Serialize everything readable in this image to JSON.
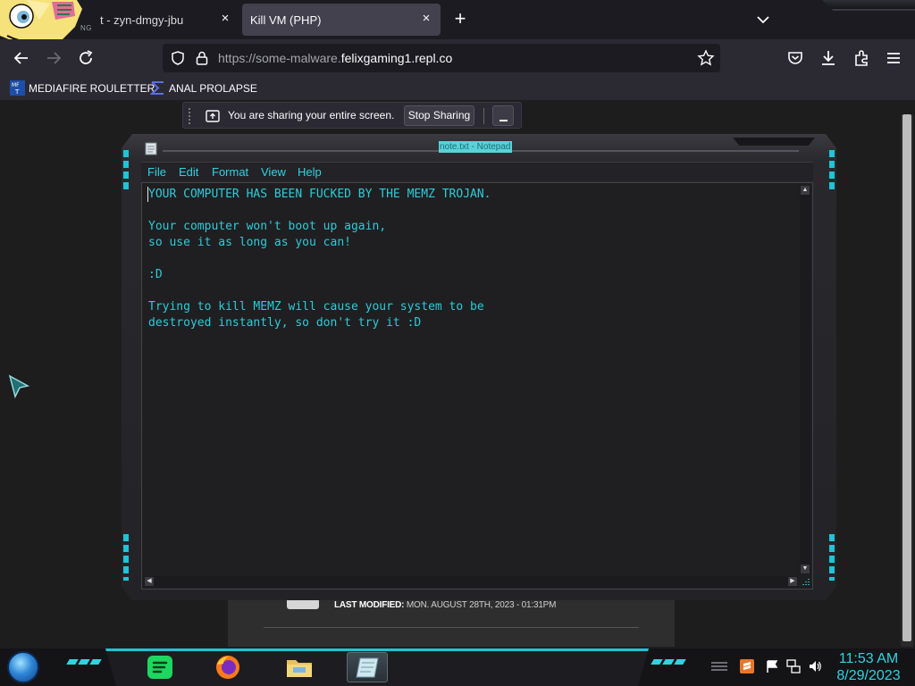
{
  "browser": {
    "tabs": [
      {
        "title": "t - zyn-dmgy-jbu",
        "subtitle": "NG",
        "close_glyph": "×"
      },
      {
        "title": "Kill VM (PHP)",
        "close_glyph": "×"
      }
    ],
    "new_tab_glyph": "+",
    "url": {
      "prefix": "https://some-malware.",
      "domain": "felixgaming1.repl.co"
    },
    "bookmarks": [
      {
        "label": "MEDIAFIRE ROULETTER",
        "icon": "mediafire-icon"
      },
      {
        "label": "ANAL PROLAPSE",
        "icon": "sigma-icon"
      }
    ]
  },
  "sharing": {
    "message": "You are sharing your entire screen.",
    "stop_label": "Stop Sharing"
  },
  "page_card": {
    "modified_label": "LAST MODIFIED:",
    "modified_value": "MON. AUGUST 28TH, 2023 - 01:31PM"
  },
  "notepad": {
    "title": "note.txt - Notepad",
    "menu": [
      "File",
      "Edit",
      "Format",
      "View",
      "Help"
    ],
    "content": "YOUR COMPUTER HAS BEEN FUCKED BY THE MEMZ TROJAN.\n\nYour computer won't boot up again,\nso use it as long as you can!\n\n:D\n\nTrying to kill MEMZ will cause your system to be\ndestroyed instantly, so don't try it :D",
    "text_color": "#2ecbd9"
  },
  "taskbar": {
    "apps": [
      "spotify-icon",
      "firefox-icon",
      "file-explorer-icon",
      "notepad-icon"
    ],
    "tray": [
      "sublime-icon",
      "flag-icon",
      "network-icon",
      "volume-icon"
    ],
    "time": "11:53 AM",
    "date": "8/29/2023",
    "accent": "#2fd3e2"
  }
}
